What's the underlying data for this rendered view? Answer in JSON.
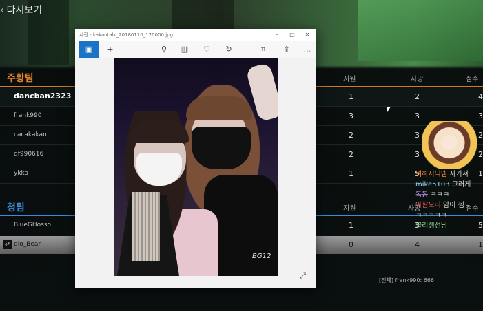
{
  "app": {
    "replay_title": "다시보기"
  },
  "teams": [
    {
      "name": "주황팀",
      "columns": [
        "지원",
        "사망",
        "점수"
      ],
      "players": [
        {
          "name": "dancban2323",
          "assist": "1",
          "death": "2",
          "score": "4"
        },
        {
          "name": "frank990",
          "assist": "3",
          "death": "3",
          "score": "3"
        },
        {
          "name": "cacakakan",
          "assist": "2",
          "death": "3",
          "score": "2"
        },
        {
          "name": "qf990616",
          "assist": "2",
          "death": "3",
          "score": "2"
        },
        {
          "name": "ykka",
          "assist": "1",
          "death": "5",
          "score": "1"
        }
      ]
    },
    {
      "name": "청팀",
      "columns": [
        "지원",
        "사망",
        "점수"
      ],
      "players": [
        {
          "name": "BlueGHosso",
          "assist": "1",
          "death": "3",
          "score": "5"
        },
        {
          "name": "dlo_Bear",
          "assist": "0",
          "death": "4",
          "score": "1"
        }
      ]
    }
  ],
  "chat": [
    {
      "user": "워하지닉넴",
      "text": "자기져",
      "color": "#ff8a3d"
    },
    {
      "user": "mike5103",
      "text": "그러게",
      "color": "#9fd5ff"
    },
    {
      "user": "독봉",
      "text": "ㅋㅋㅋ",
      "color": "#c8a0ff"
    },
    {
      "user": "아잘오리",
      "text": "얌이 쳄",
      "color": "#ff6060"
    },
    {
      "user": "",
      "text": "ㅋㅋㅋㅋㅋ",
      "color": "#ffffff"
    },
    {
      "user": "블리생선님",
      "text": "",
      "color": "#9fe89f"
    }
  ],
  "system_line": "[전체] frank990: 666",
  "photo_window": {
    "title": "사진 - kakaotalk_20180110_120000.jpg",
    "watermark": "BG12",
    "toolbar": [
      "image-icon",
      "add-icon",
      "zoom-icon",
      "delete-icon",
      "heart-icon",
      "rotate-icon",
      "crop-icon",
      "share-icon",
      "more-icon"
    ]
  },
  "colors": {
    "orange_team": "#e2862e",
    "blue_team": "#3a8ed8",
    "accent": "#1a73c7"
  }
}
